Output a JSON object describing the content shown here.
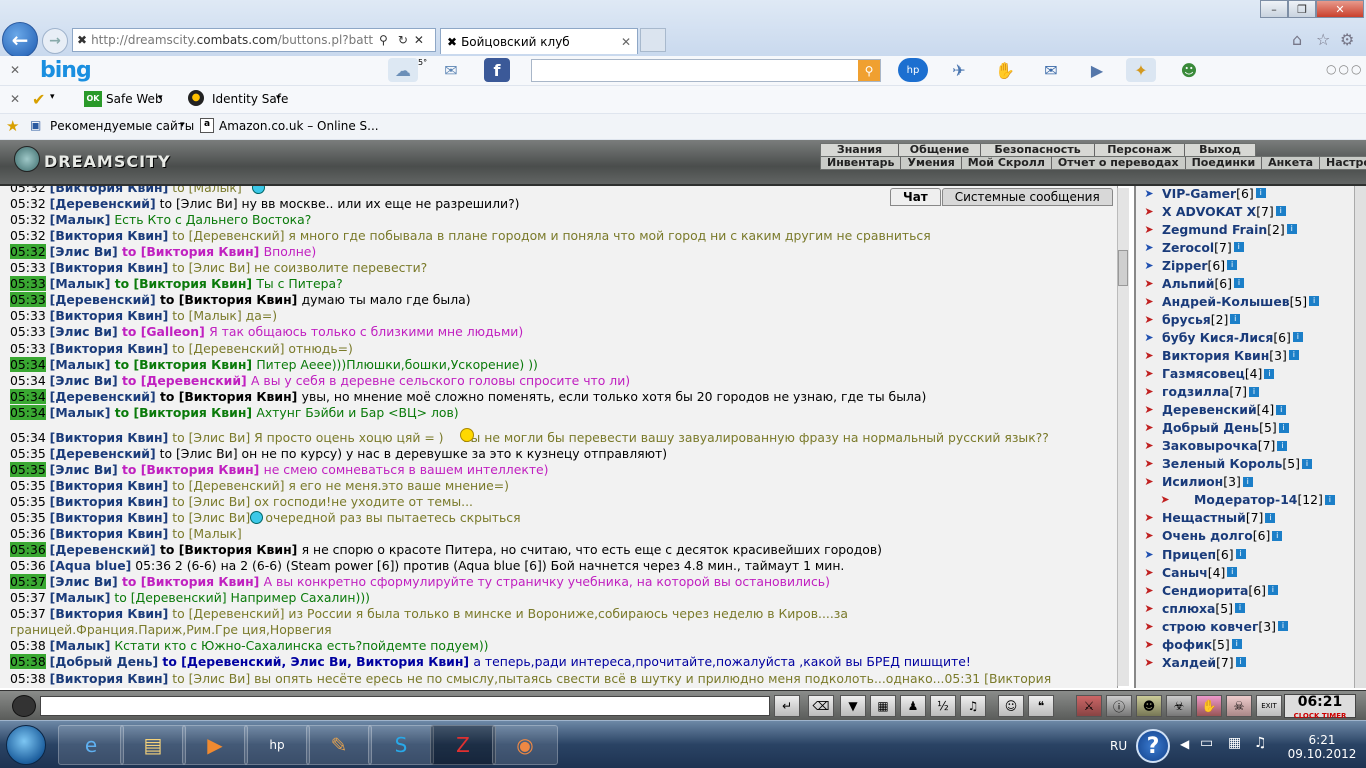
{
  "browser": {
    "url_prefix": "http://dreamscity.",
    "url_domain": "combats.com",
    "url_rest": "/buttons.pl?batt",
    "tab_title": "Бойцовский клуб",
    "window_min": "–",
    "window_max": "❐",
    "window_close": "✕"
  },
  "bing_bar": {
    "logo": "bing",
    "weather": "5°"
  },
  "safe_bar": {
    "safe_web": "Safe Web",
    "identity_safe": "Identity Safe"
  },
  "favorites": {
    "item1": "Рекомендуемые сайты",
    "item2": "Amazon.co.uk – Online S..."
  },
  "game": {
    "logo": "DREAMSCITY",
    "menu_top": [
      "Знания",
      "Общение",
      "Безопасность",
      "Персонаж",
      "Выход"
    ],
    "menu_bottom": [
      "Инвентарь",
      "Умения",
      "Мой Скролл",
      "Отчет о переводах",
      "Поединки",
      "Анкета",
      "Настройки"
    ],
    "tab_chat": "Чат",
    "tab_system": "Системные сообщения"
  },
  "chat": [
    {
      "time": "05:32",
      "hl": false,
      "name": "[Виктория Квин]",
      "to": " to [Малык] ",
      "tocls": "to-g",
      "text": "",
      "cls": "mg"
    },
    {
      "time": "05:32",
      "hl": false,
      "name": "[Деревенский]",
      "to": " to [Элис Ви] ",
      "tocls": "mk",
      "text": "ну вв москве.. или их еще не разрешили?)",
      "cls": "mk"
    },
    {
      "time": "05:32",
      "hl": false,
      "name": "[Малык]",
      "to": " ",
      "tocls": "mgr",
      "text": "Есть Кто с Дальнего Востока?",
      "cls": "mgr"
    },
    {
      "time": "05:32",
      "hl": false,
      "name": "[Виктория Квин]",
      "to": " to [Деревенский] ",
      "tocls": "to-g",
      "text": "я много где побывала в плане городом и поняла что мой город ни с каким другим не сравниться",
      "cls": "mg"
    },
    {
      "time": "05:32",
      "hl": true,
      "name": "[Элис Ви]",
      "to": " to [Виктория Квин] ",
      "tocls": "to-p",
      "text": "Вполне)",
      "cls": "mp"
    },
    {
      "time": "05:33",
      "hl": false,
      "name": "[Виктория Квин]",
      "to": " to [Элис Ви] ",
      "tocls": "to-g",
      "text": "не соизволите перевести?",
      "cls": "mg"
    },
    {
      "time": "05:33",
      "hl": true,
      "name": "[Малык]",
      "to": " to [Виктория Квин] ",
      "tocls": "to-gr",
      "text": "Ты с Питера?",
      "cls": "mgr"
    },
    {
      "time": "05:33",
      "hl": true,
      "name": "[Деревенский]",
      "to": " to [Виктория Квин] ",
      "tocls": "mkb",
      "text": "думаю ты мало где была)",
      "cls": "mk"
    },
    {
      "time": "05:33",
      "hl": false,
      "name": "[Виктория Квин]",
      "to": " to [Малык] ",
      "tocls": "to-g",
      "text": "да=)",
      "cls": "mg"
    },
    {
      "time": "05:33",
      "hl": false,
      "name": "[Элис Ви]",
      "to": " to [Galleon] ",
      "tocls": "to-p",
      "text": "Я так общаюсь только с близкими мне людьми)",
      "cls": "mp"
    },
    {
      "time": "05:33",
      "hl": false,
      "name": "[Виктория Квин]",
      "to": " to [Деревенский] ",
      "tocls": "to-g",
      "text": "отнюдь=)",
      "cls": "mg"
    },
    {
      "time": "05:34",
      "hl": true,
      "name": "[Малык]",
      "to": " to [Виктория Квин] ",
      "tocls": "to-gr",
      "text": "Питер Аеее)))Плюшки,бошки,Ускорение) ))",
      "cls": "mgr"
    },
    {
      "time": "05:34",
      "hl": false,
      "name": "[Элис Ви]",
      "to": " to [Деревенский] ",
      "tocls": "to-p",
      "text": "А вы у себя в деревне сельского головы спросите что ли)",
      "cls": "mp"
    },
    {
      "time": "05:34",
      "hl": true,
      "name": "[Деревенский]",
      "to": " to [Виктория Квин] ",
      "tocls": "mkb",
      "text": "увы, но мнение моё сложно поменять, если только хотя бы 20 городов не узнаю, где ты была)",
      "cls": "mk"
    },
    {
      "time": "05:34",
      "hl": true,
      "name": "[Малык]",
      "to": " to [Виктория Квин] ",
      "tocls": "to-gr",
      "text": "Ахтунг Бэйби и Бар <ВЦ> лов)",
      "cls": "mgr"
    },
    {
      "time": "05:34",
      "hl": false,
      "name": "[Виктория Квин]",
      "to": " to [Элис Ви] ",
      "tocls": "to-g",
      "text": "Я просто оцень хоцю цяй = )     вы не могли бы перевести вашу завуалированную фразу на нормальный русский язык??",
      "cls": "mg"
    },
    {
      "time": "05:35",
      "hl": false,
      "name": "[Деревенский]",
      "to": " to [Элис Ви] ",
      "tocls": "mk",
      "text": "он не по курсу) у нас в деревушке за это к кузнецу отправляют)",
      "cls": "mk"
    },
    {
      "time": "05:35",
      "hl": true,
      "name": "[Элис Ви]",
      "to": " to [Виктория Квин] ",
      "tocls": "to-p",
      "text": "не смею сомневаться в вашем интеллекте)",
      "cls": "mp"
    },
    {
      "time": "05:35",
      "hl": false,
      "name": "[Виктория Квин]",
      "to": " to [Деревенский] ",
      "tocls": "to-g",
      "text": "я его не меня.это ваше мнение=)",
      "cls": "mg"
    },
    {
      "time": "05:35",
      "hl": false,
      "name": "[Виктория Квин]",
      "to": " to [Элис Ви] ",
      "tocls": "to-g",
      "text": "ох господи!не уходите от темы...",
      "cls": "mg"
    },
    {
      "time": "05:35",
      "hl": false,
      "name": "[Виктория Квин]",
      "to": " to [Элис Ви] ",
      "tocls": "to-g",
      "text": "в очередной раз вы пытаетесь скрыться",
      "cls": "mg"
    },
    {
      "time": "05:36",
      "hl": false,
      "name": "[Виктория Квин]",
      "to": " to [Малык] ",
      "tocls": "to-g",
      "text": "",
      "cls": "mg"
    },
    {
      "time": "05:36",
      "hl": true,
      "name": "[Деревенский]",
      "to": " to [Виктория Квин] ",
      "tocls": "mkb",
      "text": "я не спорю о красоте Питера, но считаю, что есть еще с десяток красивейших городов)",
      "cls": "mk"
    },
    {
      "time": "05:36",
      "hl": false,
      "name": "[Aqua blue]",
      "to": " ",
      "tocls": "mk",
      "text": "05:36 2 (6-6) на 2 (6-6) (Steam power [6]) против (Aqua blue [6]) Бой начнется через 4.8 мин., таймаут 1 мин.",
      "cls": "mk"
    },
    {
      "time": "05:37",
      "hl": true,
      "name": "[Элис Ви]",
      "to": " to [Виктория Квин] ",
      "tocls": "to-p",
      "text": "А вы конкретно сформулируйте ту страничку учебника, на которой вы остановились)",
      "cls": "mp"
    },
    {
      "time": "05:37",
      "hl": false,
      "name": "[Малык]",
      "to": " to [Деревенский] ",
      "tocls": "mgr",
      "text": "Например Сахалин)))",
      "cls": "mgr"
    },
    {
      "time": "05:37",
      "hl": false,
      "name": "[Виктория Квин]",
      "to": " to [Деревенский] ",
      "tocls": "to-g",
      "text": "из России я была только в минске и Ворониже,собираюсь через неделю в Киров....за",
      "cls": "mg"
    },
    {
      "time": "",
      "hl": false,
      "name": "",
      "to": "",
      "tocls": "mg",
      "text": "границей.Франция.Париж,Рим.Гре ция,Норвегия",
      "cls": "mg",
      "wrap": true
    },
    {
      "time": "05:38",
      "hl": false,
      "name": "[Малык]",
      "to": " ",
      "tocls": "mgr",
      "text": "Кстати кто с Южно-Сахалинска есть?пойдемте подуем))",
      "cls": "mgr"
    },
    {
      "time": "05:38",
      "hl": true,
      "name": "[Добрый День]",
      "to": " to [Деревенский, Элис Ви, Виктория Квин] ",
      "tocls": "mbl",
      "text": "а теперь,ради интереса,прочитайте,пожалуйста ,какой вы БРЕД пишщите!",
      "cls": "mbl"
    },
    {
      "time": "05:38",
      "hl": false,
      "name": "[Виктория Квин]",
      "to": " to [Элис Ви] ",
      "tocls": "to-g",
      "text": "вы опять несёте ересь не по смыслу,пытаясь свести всё в шутку и прилюдно меня подколоть...однако...05:31 [Виктория",
      "cls": "mg"
    }
  ],
  "users": [
    {
      "name": "VIP-Gamer",
      "lvl": "[6]"
    },
    {
      "name": "X ADVOKAT X",
      "lvl": "[7]"
    },
    {
      "name": "Zegmund Frain",
      "lvl": "[2]"
    },
    {
      "name": "Zerocol",
      "lvl": "[7]"
    },
    {
      "name": "Zipper",
      "lvl": "[6]"
    },
    {
      "name": "Альпий",
      "lvl": "[6]"
    },
    {
      "name": "Андрей-Колышев",
      "lvl": "[5]"
    },
    {
      "name": "брусья",
      "lvl": "[2]"
    },
    {
      "name": "бубу Кися-Лися",
      "lvl": "[6]"
    },
    {
      "name": "Виктория Квин",
      "lvl": "[3]"
    },
    {
      "name": "Газмясовец",
      "lvl": "[4]"
    },
    {
      "name": "годзилла",
      "lvl": "[7]"
    },
    {
      "name": "Деревенский",
      "lvl": "[4]"
    },
    {
      "name": "Добрый День",
      "lvl": "[5]"
    },
    {
      "name": "Заковырочка",
      "lvl": "[7]"
    },
    {
      "name": "Зеленый Король",
      "lvl": "[5]"
    },
    {
      "name": "Исилион",
      "lvl": "[3]"
    },
    {
      "name": "Модератор-14",
      "lvl": "[12]"
    },
    {
      "name": "Нещастный",
      "lvl": "[7]"
    },
    {
      "name": "Очень долго",
      "lvl": "[6]"
    },
    {
      "name": "Прицеп",
      "lvl": "[6]"
    },
    {
      "name": "Саныч",
      "lvl": "[4]"
    },
    {
      "name": "Сендиорита",
      "lvl": "[6]"
    },
    {
      "name": "сплюха",
      "lvl": "[5]"
    },
    {
      "name": "строю ковчег",
      "lvl": "[3]"
    },
    {
      "name": "фофик",
      "lvl": "[5]"
    },
    {
      "name": "Халдей",
      "lvl": "[7]"
    }
  ],
  "clock": {
    "time": "06:21",
    "label": "CLOCK TIMER"
  },
  "taskbar": {
    "lang": "RU",
    "time": "6:21",
    "date": "09.10.2012"
  }
}
